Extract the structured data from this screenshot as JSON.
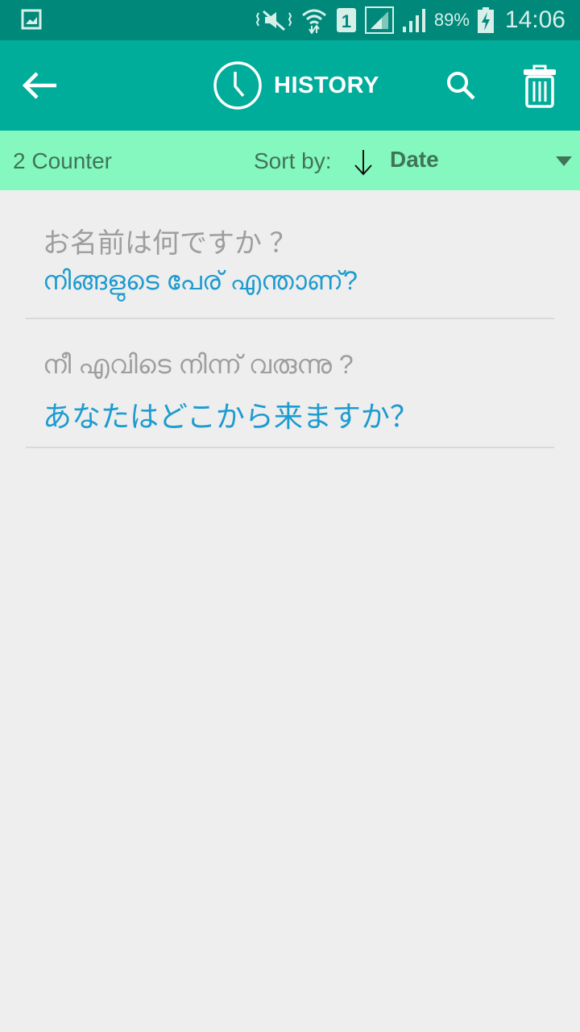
{
  "status_bar": {
    "icons": [
      "gallery-icon",
      "mute-vibrate-icon",
      "wifi-icon",
      "sim-1-icon",
      "signal-box-icon",
      "signal-icon",
      "battery-charging-icon"
    ],
    "battery": "89%",
    "time": "14:06"
  },
  "app_bar": {
    "title": "HISTORY",
    "back_icon": "arrow-left-icon",
    "title_icon": "clock-icon",
    "actions": [
      "search-icon",
      "trash-icon"
    ]
  },
  "sort_bar": {
    "counter": "2 Counter",
    "sort_label": "Sort by:",
    "sort_direction_icon": "arrow-down-icon",
    "sort_value": "Date"
  },
  "history": [
    {
      "source": "お名前は何ですか ？",
      "translation": "നിങ്ങളുടെ പേര് എന്താണ്?"
    },
    {
      "source": "നീ എവിടെ നിന്ന് വരുന്നു ?",
      "translation": "あなたはどこから来ますか？"
    }
  ],
  "colors": {
    "status_bar": "#00897b",
    "app_bar": "#00ad9a",
    "sort_bar": "#85f8bf",
    "source_text": "#9e9e9e",
    "translation_text": "#1e9bcf"
  }
}
